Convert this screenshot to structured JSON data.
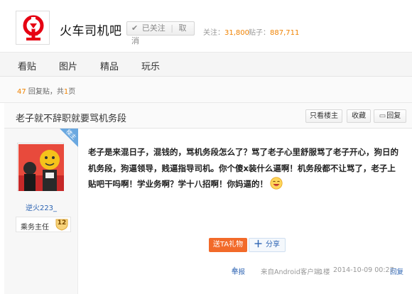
{
  "forum": {
    "name": "火车司机吧",
    "follow_label": "已关注",
    "cancel_label": "取消",
    "followers_label": "关注：",
    "followers_value": "31,800",
    "posts_label": "贴子：",
    "posts_value": "887,711",
    "logo_icon": "china-railway-logo",
    "brand_color": "#e60012"
  },
  "nav": {
    "tabs": [
      "看贴",
      "图片",
      "精品",
      "玩乐"
    ]
  },
  "thread_info": {
    "reply_count": "47",
    "reply_text": "回复贴，共",
    "page_count": "1",
    "page_suffix": "页"
  },
  "thread": {
    "title": "老子就不辞职就要骂机务段",
    "only_op_label": "只看楼主",
    "favorite_label": "收藏",
    "reply_label": "回复"
  },
  "post": {
    "author": "逆火223_",
    "rank": "乘务主任",
    "level": "12",
    "op_badge": "楼主",
    "content": "老子是来混日子，混钱的，骂机务段怎么了？骂了老子心里舒服骂了老子开心，狗日的机务段，狗逼领导，贱逼指导司机。你个傻x装什么逼啊！机务段都不让骂了，老子上贴吧干吗啊！学业务啊？学十八招啊！你妈逼的！",
    "gift_label": "送TA礼物",
    "share_label": "分享",
    "report_label": "举报",
    "client": "来自Android客户端",
    "floor": "1楼",
    "time": "2014-10-09 00:27",
    "reply_label": "回复",
    "accent_color": "#2d64b3",
    "gift_color": "#f26a2a"
  }
}
